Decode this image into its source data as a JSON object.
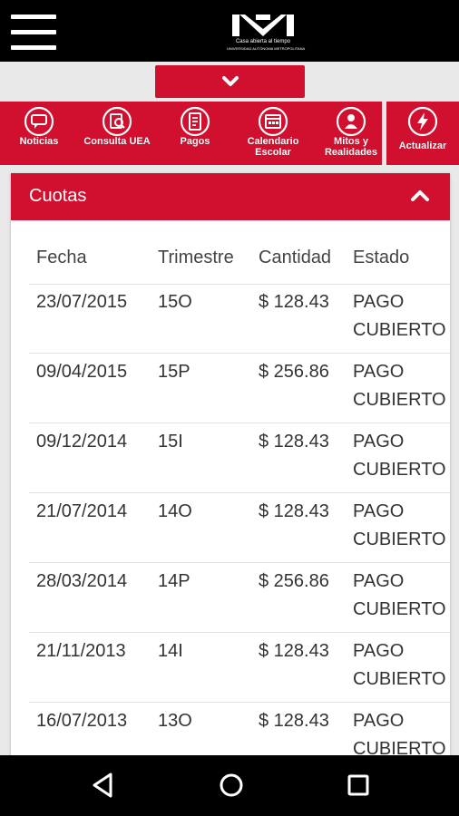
{
  "header": {
    "logo_tagline": "Casa abierta al tiempo",
    "logo_subtagline": "UNIVERSIDAD AUTÓNOMA METROPOLITANA",
    "accent_color": "#d0102e"
  },
  "nav": {
    "items": [
      {
        "label": "Noticias",
        "icon": "speech-bubble-icon"
      },
      {
        "label": "Consulta UEA",
        "icon": "search-document-icon"
      },
      {
        "label": "Pagos",
        "icon": "receipt-icon"
      },
      {
        "label": "Calendario Escolar",
        "icon": "calendar-icon"
      },
      {
        "label": "Mitos y Realidades",
        "icon": "person-icon"
      },
      {
        "label": "Actualizar",
        "icon": "refresh-lightning-icon"
      }
    ]
  },
  "card": {
    "title": "Cuotas",
    "columns": [
      "Fecha",
      "Trimestre",
      "Cantidad",
      "Estado"
    ],
    "rows": [
      {
        "fecha": "23/07/2015",
        "trimestre": "15O",
        "cantidad": "$ 128.43",
        "estado": "PAGO CUBIERTO"
      },
      {
        "fecha": "09/04/2015",
        "trimestre": "15P",
        "cantidad": "$ 256.86",
        "estado": "PAGO CUBIERTO"
      },
      {
        "fecha": "09/12/2014",
        "trimestre": "15I",
        "cantidad": "$ 128.43",
        "estado": "PAGO CUBIERTO"
      },
      {
        "fecha": "21/07/2014",
        "trimestre": "14O",
        "cantidad": "$ 128.43",
        "estado": "PAGO CUBIERTO"
      },
      {
        "fecha": "28/03/2014",
        "trimestre": "14P",
        "cantidad": "$ 256.86",
        "estado": "PAGO CUBIERTO"
      },
      {
        "fecha": "21/11/2013",
        "trimestre": "14I",
        "cantidad": "$ 128.43",
        "estado": "PAGO CUBIERTO"
      },
      {
        "fecha": "16/07/2013",
        "trimestre": "13O",
        "cantidad": "$ 128.43",
        "estado": "PAGO CUBIERTO"
      }
    ]
  }
}
